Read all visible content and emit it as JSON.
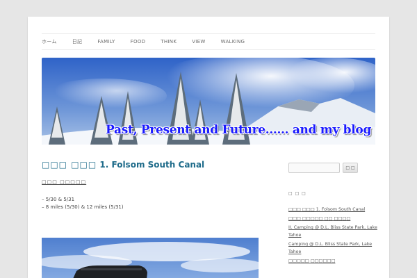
{
  "nav": {
    "items": [
      "ホーム",
      "日記",
      "FAMILY",
      "FOOD",
      "THINK",
      "VIEW",
      "WALKING"
    ]
  },
  "header": {
    "title": "Past, Present and Future…… and my blog"
  },
  "post": {
    "title_prefix": "□□□ □□□",
    "title_main": "1. Folsom South Canal",
    "category": "□□□ □□□□□",
    "lines": [
      "– 5/30 & 5/31",
      "– 8 miles (5/30) & 12 miles (5/31)"
    ]
  },
  "sidebar": {
    "search_placeholder": "",
    "search_button": "□ □",
    "widget_title": "□ □ □",
    "recent_posts": [
      "□□□ □□□ 1. Folsom South Canal",
      "□□□ □□□□□ □□ □□□□",
      "II. Camping @ D.L. Bliss State Park, Lake Tahoe",
      "Camping @ D.L. Bliss State Park, Lake Tahoe",
      "□□□□□ □□□□□□"
    ]
  },
  "colors": {
    "title_blue": "#1a1aff",
    "link_teal": "#1e6b8a",
    "background": "#e6e6e6"
  }
}
